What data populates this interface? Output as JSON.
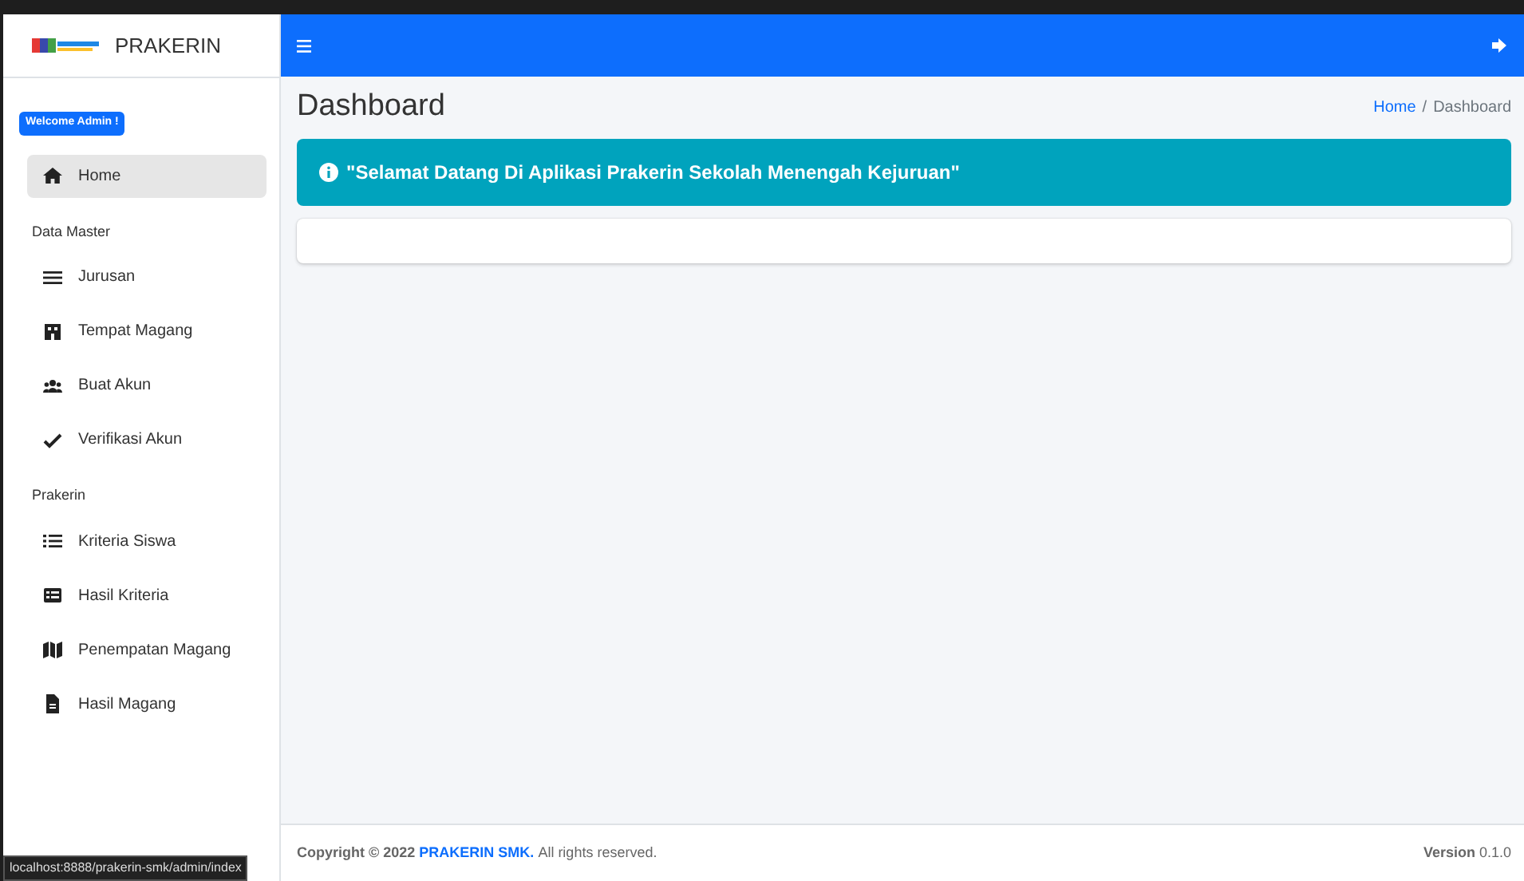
{
  "brand": {
    "title": "PRAKERIN"
  },
  "user_badge": "Welcome Admin !",
  "sidebar": {
    "items": [
      {
        "kind": "link",
        "label": "Home",
        "selected": true
      },
      {
        "kind": "header",
        "label": "Data Master"
      },
      {
        "kind": "link",
        "label": "Jurusan",
        "selected": false
      },
      {
        "kind": "link",
        "label": "Tempat Magang",
        "selected": false
      },
      {
        "kind": "link",
        "label": "Buat Akun",
        "selected": false
      },
      {
        "kind": "link",
        "label": "Verifikasi Akun",
        "selected": false
      },
      {
        "kind": "header",
        "label": "Prakerin"
      },
      {
        "kind": "link",
        "label": "Kriteria Siswa",
        "selected": false
      },
      {
        "kind": "link",
        "label": "Hasil Kriteria",
        "selected": false
      },
      {
        "kind": "link",
        "label": "Penempatan Magang",
        "selected": false
      },
      {
        "kind": "link",
        "label": "Hasil Magang",
        "selected": false
      }
    ]
  },
  "page": {
    "title": "Dashboard",
    "breadcrumb": [
      {
        "kind": "link",
        "label": "Home"
      },
      {
        "kind": "separator",
        "label": "/"
      },
      {
        "kind": "current",
        "label": "Dashboard"
      }
    ]
  },
  "alert": {
    "text": "\"Selamat Datang Di Aplikasi Prakerin Sekolah Menengah Kejuruan\""
  },
  "footer": {
    "copyright": "Copyright © 2022",
    "brand": "PRAKERIN SMK.",
    "rights": "All rights reserved.",
    "version_label": "Version",
    "version": "0.1.0"
  },
  "status_bar": "localhost:8888/prakerin-smk/admin/index"
}
